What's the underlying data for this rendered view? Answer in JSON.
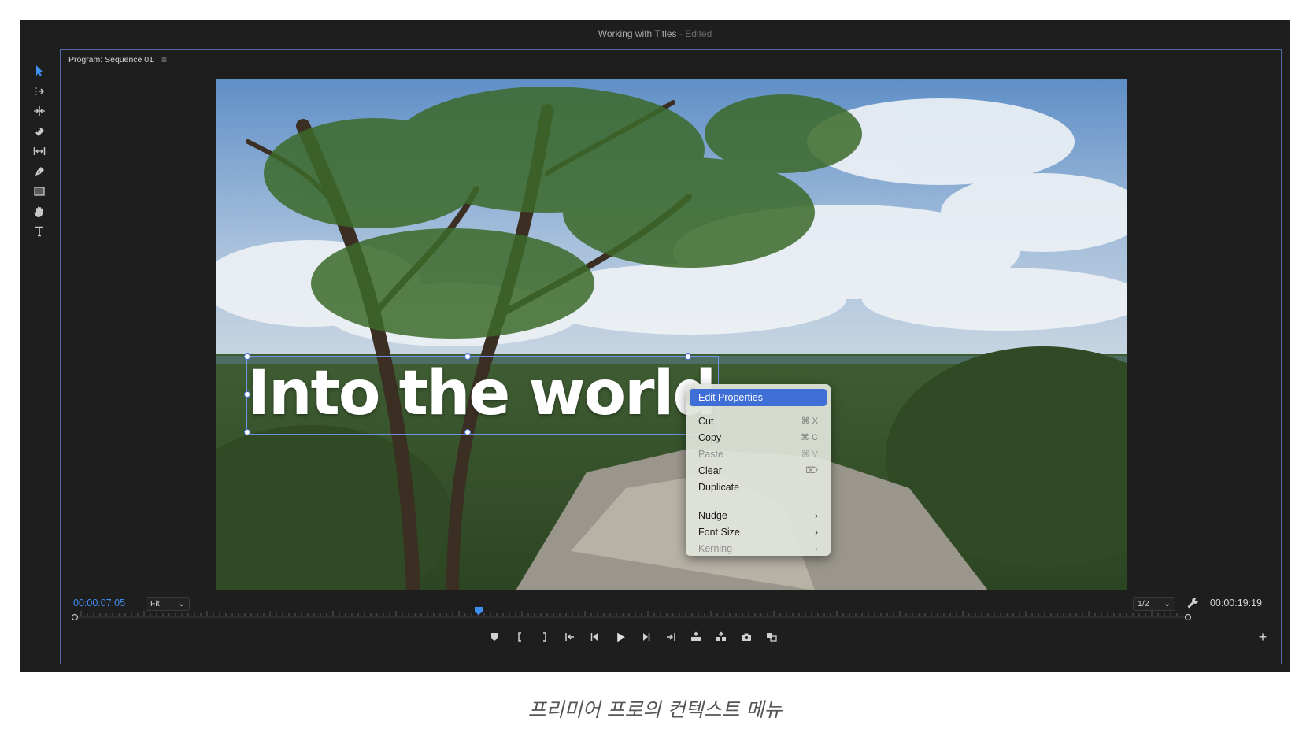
{
  "window": {
    "title": "Working with Titles",
    "status": "Edited"
  },
  "toolbar": {
    "tools": [
      {
        "name": "selection-tool",
        "icon": "arrow-icon",
        "active": true
      },
      {
        "name": "track-select-tool",
        "icon": "track-select-icon"
      },
      {
        "name": "ripple-edit-tool",
        "icon": "ripple-edit-icon"
      },
      {
        "name": "razor-tool",
        "icon": "razor-icon"
      },
      {
        "name": "slip-tool",
        "icon": "slip-icon"
      },
      {
        "name": "pen-tool",
        "icon": "pen-icon"
      },
      {
        "name": "rectangle-tool",
        "icon": "rectangle-icon"
      },
      {
        "name": "hand-tool",
        "icon": "hand-icon"
      },
      {
        "name": "type-tool",
        "icon": "type-icon"
      }
    ]
  },
  "panel": {
    "title": "Program: Sequence 01",
    "menu_icon": "hamburger-icon"
  },
  "title_overlay": {
    "text": "Into the world"
  },
  "context_menu": {
    "items": [
      {
        "label": "Edit Properties",
        "shortcut": "",
        "state": "highlighted"
      },
      {
        "label": "Cut",
        "shortcut": "⌘ X",
        "state": "enabled"
      },
      {
        "label": "Copy",
        "shortcut": "⌘ C",
        "state": "enabled"
      },
      {
        "label": "Paste",
        "shortcut": "⌘ V",
        "state": "disabled"
      },
      {
        "label": "Clear",
        "shortcut": "⌦",
        "state": "enabled"
      },
      {
        "label": "Duplicate",
        "shortcut": "",
        "state": "enabled"
      },
      {
        "label": "Nudge",
        "shortcut": "›",
        "state": "enabled"
      },
      {
        "label": "Font Size",
        "shortcut": "›",
        "state": "enabled"
      },
      {
        "label": "Kerning",
        "shortcut": "›",
        "state": "disabled"
      }
    ]
  },
  "playback": {
    "current_time": "00:00:07:05",
    "zoom": "Fit",
    "resolution": "1/2",
    "duration": "00:00:19:19",
    "playhead_fraction": 0.363
  },
  "transport": {
    "buttons": [
      "marker-icon",
      "mark-in-icon",
      "mark-out-icon",
      "go-to-in-icon",
      "step-back-icon",
      "play-icon",
      "step-forward-icon",
      "go-to-out-icon",
      "lift-icon",
      "extract-icon",
      "camera-icon",
      "compare-icon"
    ]
  },
  "caption": "프리미어 프로의 컨텍스트 메뉴",
  "colors": {
    "accent": "#3f8ff0",
    "panel_border": "#4f6ba8",
    "menu_highlight": "#3f6fd6"
  }
}
